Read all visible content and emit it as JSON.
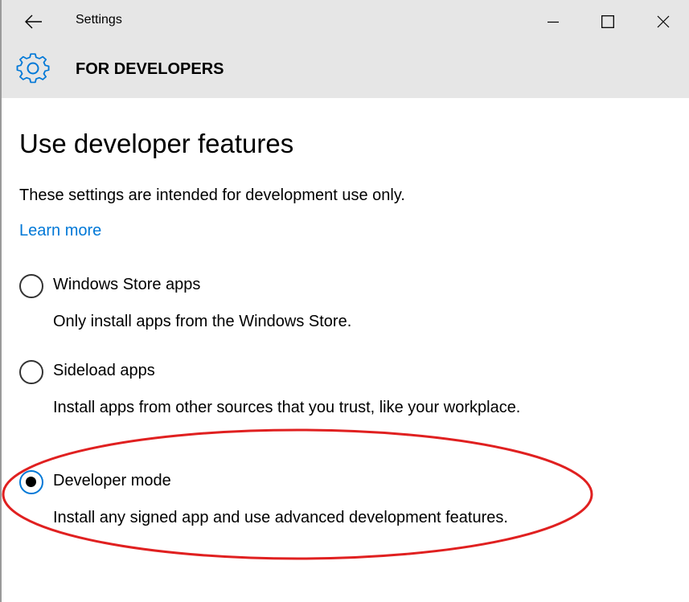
{
  "window": {
    "title": "Settings",
    "controls": {
      "back_icon": "arrow-left-icon",
      "minimize_icon": "minimize-icon",
      "maximize_icon": "maximize-icon",
      "close_icon": "close-icon"
    }
  },
  "header": {
    "icon": "gear-icon",
    "title": "FOR DEVELOPERS"
  },
  "main": {
    "heading": "Use developer features",
    "description": "These settings are intended for development use only.",
    "learn_more": "Learn more",
    "options": [
      {
        "label": "Windows Store apps",
        "description": "Only install apps from the Windows Store.",
        "selected": false
      },
      {
        "label": "Sideload apps",
        "description": "Install apps from other sources that you trust, like your workplace.",
        "selected": false
      },
      {
        "label": "Developer mode",
        "description": "Install any signed app and use advanced development features.",
        "selected": true
      }
    ]
  },
  "colors": {
    "accent": "#0078d7",
    "titlebar_bg": "#e6e6e6",
    "annotation": "#e02020"
  }
}
